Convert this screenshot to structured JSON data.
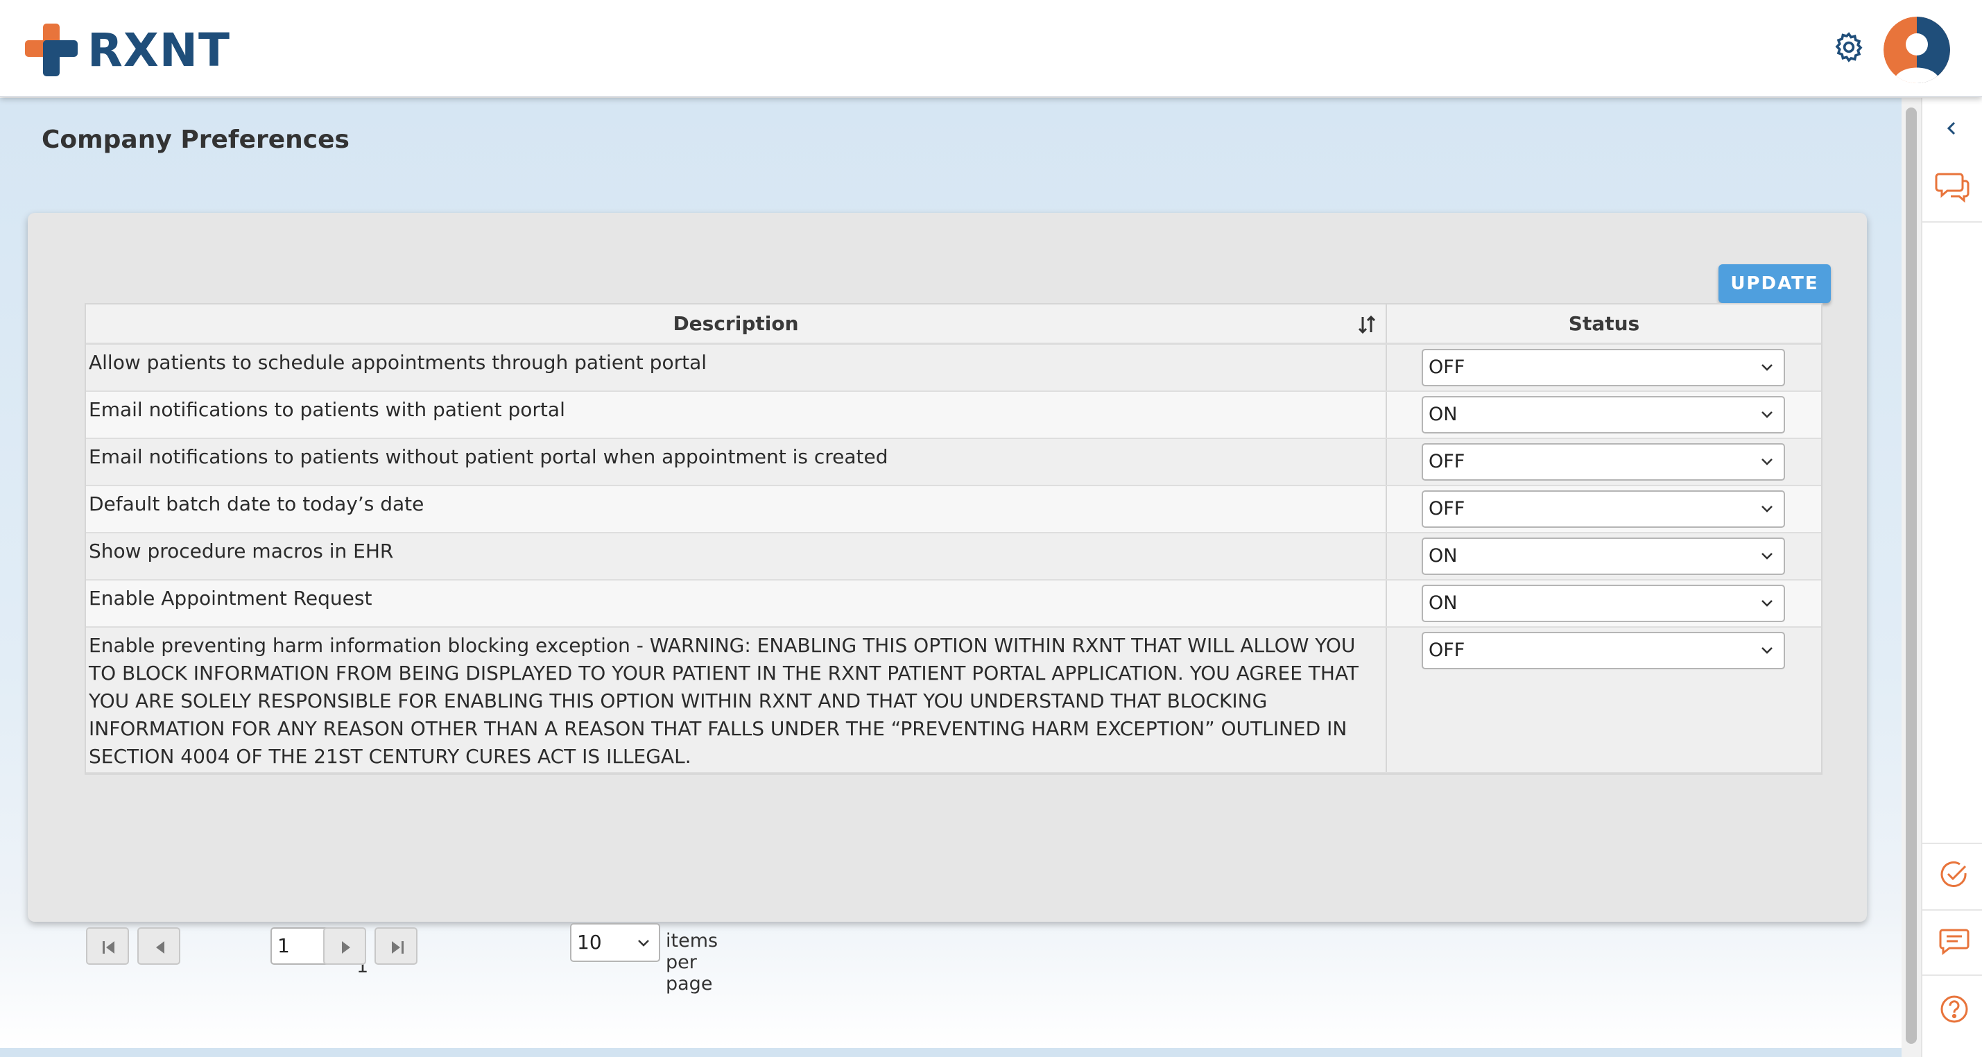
{
  "app": {
    "logo_text": "RXNT",
    "colors": {
      "brand_blue": "#1f4e7a",
      "brand_orange": "#e8743b",
      "accent": "#4f9fde"
    }
  },
  "header": {
    "settings_icon": "gear-icon",
    "avatar_icon": "user-avatar"
  },
  "page": {
    "title": "Company Preferences",
    "update_label": "UPDATE"
  },
  "table": {
    "columns": {
      "description": "Description",
      "status": "Status"
    },
    "rows": [
      {
        "description": "Allow patients to schedule appointments through patient portal",
        "status": "OFF"
      },
      {
        "description": "Email notifications to patients with patient portal",
        "status": "ON"
      },
      {
        "description": "Email notifications to patients without patient portal when appointment is created",
        "status": "OFF"
      },
      {
        "description": "Default batch date to today’s date",
        "status": "OFF"
      },
      {
        "description": "Show procedure macros in EHR",
        "status": "ON"
      },
      {
        "description": "Enable Appointment Request",
        "status": "ON"
      },
      {
        "description": "Enable preventing harm information blocking exception - WARNING: ENABLING THIS OPTION WITHIN RXNT THAT WILL ALLOW YOU TO BLOCK INFORMATION FROM BEING DISPLAYED TO YOUR PATIENT IN THE RXNT PATIENT PORTAL APPLICATION. YOU AGREE THAT YOU ARE SOLELY RESPONSIBLE FOR ENABLING THIS OPTION WITHIN RXNT AND THAT YOU UNDERSTAND THAT BLOCKING INFORMATION FOR ANY REASON OTHER THAN A REASON THAT FALLS UNDER THE “PREVENTING HARM EXCEPTION” OUTLINED IN SECTION 4004 OF THE 21ST CENTURY CURES ACT IS ILLEGAL.",
        "status": "OFF"
      }
    ]
  },
  "pager": {
    "current_page": "1",
    "total_pages": "/ 1",
    "per_page": "10",
    "per_page_label": "items per page"
  },
  "rail": {
    "icons": [
      "chevron-left-icon",
      "chat-icon",
      "check-circle-icon",
      "message-icon",
      "help-icon"
    ]
  }
}
